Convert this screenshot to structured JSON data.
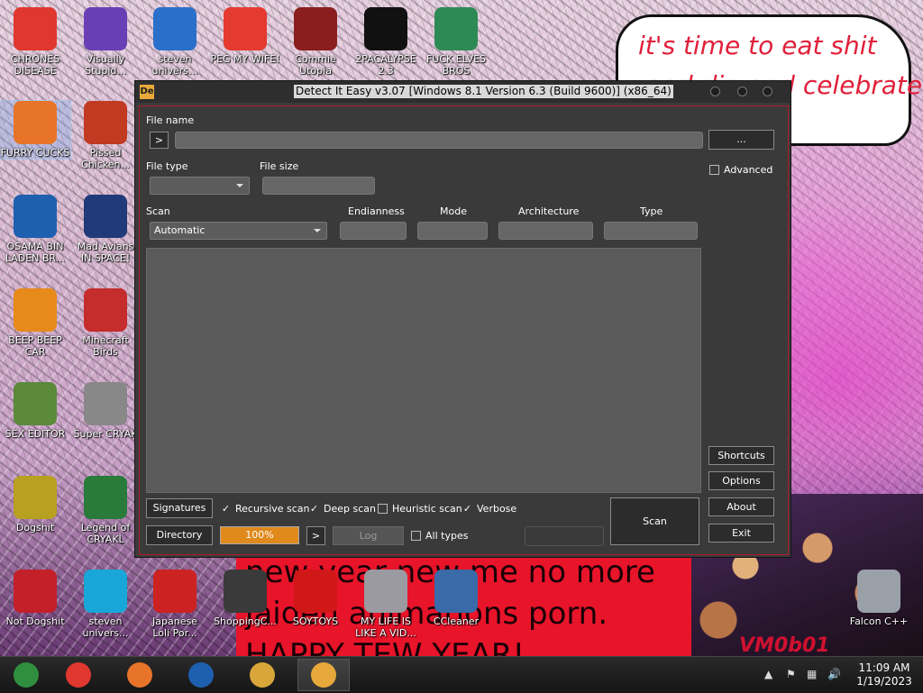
{
  "desktop": {
    "speech_lines": [
      "it's time to eat shit",
      "and die and celebrate"
    ],
    "banner_lines": [
      "new year new me no more",
      "jaiden animations porn.",
      "HAPPY TEW YEAR!"
    ],
    "corner_tag": "VM0b01",
    "icons": [
      {
        "label": "CHRONES\nDISEASE",
        "icon": "chrome-icon",
        "color": "#e0372e"
      },
      {
        "label": "Visually\nStupid...",
        "icon": "visual-studio-icon",
        "color": "#6a3fb5"
      },
      {
        "label": "steven\nunivers...",
        "icon": "game-icon",
        "color": "#2a6fc9"
      },
      {
        "label": "PEG MY WIFE!",
        "icon": "pac-icon",
        "color": "#e53a2f"
      },
      {
        "label": "Commie\nUtopia",
        "icon": "utopia-icon",
        "color": "#8a1e1e"
      },
      {
        "label": "2PACALYPSE\n2.3",
        "icon": "terminal-icon",
        "color": "#111111"
      },
      {
        "label": "FUCK ELVES\nBROS",
        "icon": "elf-icon",
        "color": "#2e8a55"
      },
      {
        "label": "FURRY CUCKS",
        "icon": "firefox-icon",
        "color": "#e8742a"
      },
      {
        "label": "Pissed\nChicken...",
        "icon": "angry-birds-seasons-icon",
        "color": "#c23a22"
      },
      {
        "label": "OSAMA BIN\nLADEN BR...",
        "icon": "obama-logo-icon",
        "color": "#1f5fb0"
      },
      {
        "label": "Mad Avians\nIN SPACE!",
        "icon": "angry-birds-space-icon",
        "color": "#203a7a"
      },
      {
        "label": "BEEP BEEP\nCAR",
        "icon": "vlc-icon",
        "color": "#e88a1a"
      },
      {
        "label": "Minecraft\nBirds",
        "icon": "angry-birds-icon",
        "color": "#c52c2c"
      },
      {
        "label": "SEX EDITOR",
        "icon": "hxd-icon",
        "color": "#5a8a3a"
      },
      {
        "label": "Super CRYAK",
        "icon": "pixel-cat-icon",
        "color": "#888888"
      },
      {
        "label": "Dogshit",
        "icon": "dogshit-icon",
        "color": "#b8a020"
      },
      {
        "label": "Legend of\nCRYAKL",
        "icon": "legend-icon",
        "color": "#2a7a3a"
      },
      {
        "label": "Not Dogshit",
        "icon": "devcpp-icon",
        "color": "#c3202a"
      },
      {
        "label": "steven\nunivers...",
        "icon": "diamond-icon",
        "color": "#18a7d8"
      },
      {
        "label": "Japanese\nLoli Por...",
        "icon": "torii-icon",
        "color": "#cc2222"
      },
      {
        "label": "ShoppingC...",
        "icon": "flash-icon",
        "color": "#3a3a3a"
      },
      {
        "label": "SOYTOYS",
        "icon": "s-logo-icon",
        "color": "#d01818"
      },
      {
        "label": "MY LIFE IS\nLIKE A VID...",
        "icon": "gamepad-icon",
        "color": "#9a9aa0"
      },
      {
        "label": "CCleaner",
        "icon": "ccleaner-icon",
        "color": "#3a6aa8"
      },
      {
        "label": "Falcon C++",
        "icon": "trash-icon",
        "color": "#9aa0a8"
      }
    ]
  },
  "window": {
    "title": "Detect It Easy v3.07 [Windows 8.1 Version 6.3 (Build 9600)] (x86_64)",
    "app_icon_text": "De",
    "file_name_label": "File name",
    "browse_arrow": ">",
    "browse_button": "...",
    "file_type_label": "File type",
    "file_size_label": "File size",
    "advanced_label": "Advanced",
    "scan_label": "Scan",
    "scan_mode_value": "Automatic",
    "endianness_label": "Endianness",
    "mode_label": "Mode",
    "architecture_label": "Architecture",
    "type_label": "Type",
    "signatures_button": "Signatures",
    "directory_button": "Directory",
    "recursive_label": "Recursive scan",
    "deep_label": "Deep scan",
    "heuristic_label": "Heuristic scan",
    "verbose_label": "Verbose",
    "all_types_label": "All types",
    "progress_text": "100%",
    "progress_value": 1.0,
    "next_button": ">",
    "log_button": "Log",
    "scan_button": "Scan",
    "shortcuts_button": "Shortcuts",
    "options_button": "Options",
    "about_button": "About",
    "exit_button": "Exit",
    "checked_glyph": "✓"
  },
  "taskbar": {
    "items": [
      {
        "icon": "start-icon",
        "color": "#2f8f3f"
      },
      {
        "icon": "chrome-taskbar-icon",
        "color": "#e0372e"
      },
      {
        "icon": "firefox-taskbar-icon",
        "color": "#e8742a"
      },
      {
        "icon": "obama-taskbar-icon",
        "color": "#1f5fb0"
      },
      {
        "icon": "file-explorer-icon",
        "color": "#d9a63a"
      },
      {
        "icon": "die-taskbar-icon",
        "color": "#e7a93b"
      }
    ],
    "time": "11:09 AM",
    "date": "1/19/2023"
  }
}
